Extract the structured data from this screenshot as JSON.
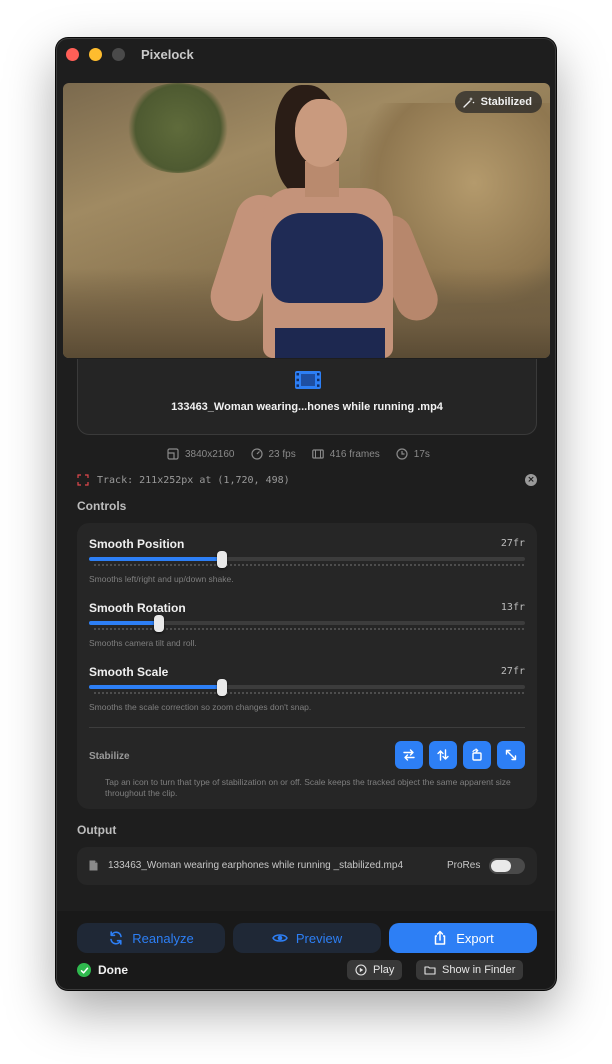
{
  "window": {
    "title": "Pixelock"
  },
  "video": {
    "badge_label": "Stabilized"
  },
  "file": {
    "name": "133463_Woman wearing...hones while running .mp4"
  },
  "meta": {
    "resolution": "3840x2160",
    "fps": "23 fps",
    "frames": "416 frames",
    "duration": "17s"
  },
  "track": {
    "text": "Track: 211x252px at (1,720, 498)"
  },
  "controls": {
    "title": "Controls",
    "sliders": [
      {
        "label": "Smooth Position",
        "value_text": "27fr",
        "fraction": 0.306,
        "hint": "Smooths left/right and up/down shake."
      },
      {
        "label": "Smooth Rotation",
        "value_text": "13fr",
        "fraction": 0.161,
        "hint": "Smooths camera tilt and roll."
      },
      {
        "label": "Smooth Scale",
        "value_text": "27fr",
        "fraction": 0.306,
        "hint": "Smooths the scale correction so zoom changes don't snap."
      }
    ],
    "stabilize_label": "Stabilize",
    "stabilize_hint": "Tap an icon to turn that type of stabilization on or off. Scale keeps the tracked object the same apparent size throughout the clip.",
    "stabilize_buttons": [
      "horizontal-arrows-icon",
      "vertical-arrows-icon",
      "rotation-icon",
      "scale-arrows-icon"
    ]
  },
  "output": {
    "title": "Output",
    "filename": "133463_Woman wearing earphones while running _stabilized.mp4",
    "prores_label": "ProRes",
    "prores_on": false
  },
  "footer": {
    "reanalyze_label": "Reanalyze",
    "preview_label": "Preview",
    "export_label": "Export",
    "status_label": "Done",
    "play_label": "Play",
    "show_in_finder_label": "Show in Finder"
  },
  "colors": {
    "accent": "#2d7ff5",
    "success": "#2fb94e",
    "close": "#ff5f57",
    "minimize": "#febc2e"
  }
}
